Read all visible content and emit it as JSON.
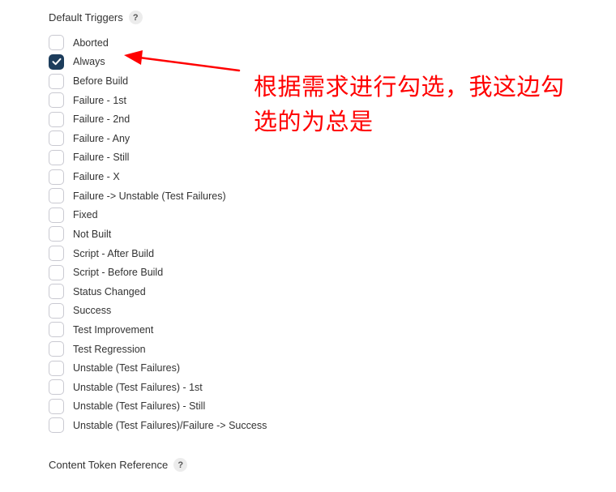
{
  "default_triggers": {
    "title": "Default Triggers",
    "help_glyph": "?",
    "items": [
      {
        "label": "Aborted",
        "checked": false
      },
      {
        "label": "Always",
        "checked": true
      },
      {
        "label": "Before Build",
        "checked": false
      },
      {
        "label": "Failure - 1st",
        "checked": false
      },
      {
        "label": "Failure - 2nd",
        "checked": false
      },
      {
        "label": "Failure - Any",
        "checked": false
      },
      {
        "label": "Failure - Still",
        "checked": false
      },
      {
        "label": "Failure - X",
        "checked": false
      },
      {
        "label": "Failure -> Unstable (Test Failures)",
        "checked": false
      },
      {
        "label": "Fixed",
        "checked": false
      },
      {
        "label": "Not Built",
        "checked": false
      },
      {
        "label": "Script - After Build",
        "checked": false
      },
      {
        "label": "Script - Before Build",
        "checked": false
      },
      {
        "label": "Status Changed",
        "checked": false
      },
      {
        "label": "Success",
        "checked": false
      },
      {
        "label": "Test Improvement",
        "checked": false
      },
      {
        "label": "Test Regression",
        "checked": false
      },
      {
        "label": "Unstable (Test Failures)",
        "checked": false
      },
      {
        "label": "Unstable (Test Failures) - 1st",
        "checked": false
      },
      {
        "label": "Unstable (Test Failures) - Still",
        "checked": false
      },
      {
        "label": "Unstable (Test Failures)/Failure -> Success",
        "checked": false
      }
    ]
  },
  "content_token_reference": {
    "title": "Content Token Reference",
    "help_glyph": "?"
  },
  "annotation": {
    "line1": "根据需求进行勾选，我这边勾",
    "line2": "选的为总是",
    "color": "#ff0000"
  },
  "colors": {
    "checkbox_checked": "#1d3d5c",
    "checkbox_border": "#c9c9d1",
    "text": "#333333"
  },
  "icons": {
    "checkmark": "checkmark-icon",
    "help": "help-icon",
    "arrow": "red-arrow-annotation"
  }
}
